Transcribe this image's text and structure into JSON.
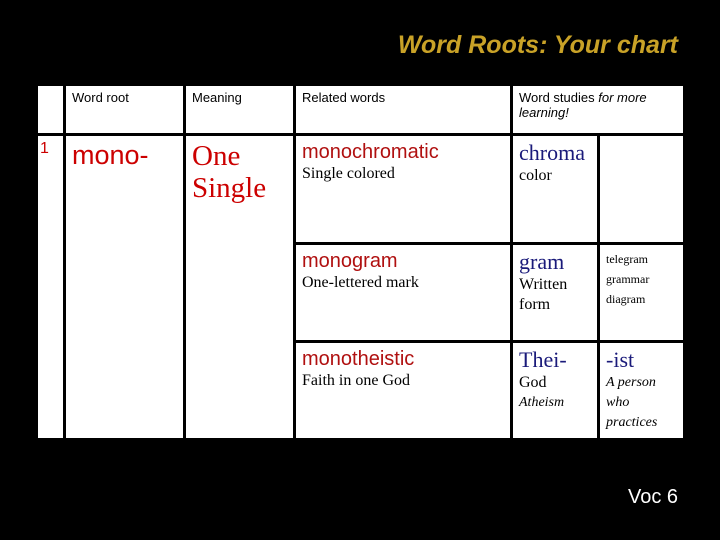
{
  "title": "Word Roots: Your chart",
  "header": {
    "col_number": "",
    "col_root": "Word root",
    "col_meaning": "Meaning",
    "col_related": "Related words",
    "col_studies_main": "Word studies ",
    "col_studies_italic": "for more learning!"
  },
  "entry": {
    "number": "1",
    "root": "mono-",
    "meaning_line1": "One",
    "meaning_line2": "Single"
  },
  "rows": [
    {
      "related_word": "monochromatic",
      "related_def": "Single colored",
      "study_word": "chroma",
      "study_def": "color",
      "study_example": "",
      "more_word": "",
      "more_items": []
    },
    {
      "related_word": "monogram",
      "related_def": "One-lettered mark",
      "study_word": "gram",
      "study_def": "Written form",
      "study_example": "",
      "more_word": "",
      "more_items": [
        "telegram",
        "grammar",
        "diagram"
      ]
    },
    {
      "related_word": "monotheistic",
      "related_def": "Faith in one God",
      "study_word": "Thei-",
      "study_def": "God",
      "study_example": "Atheism",
      "more_word": "-ist",
      "more_def": "A person who practices"
    }
  ],
  "footer": {
    "label": "Voc 6"
  },
  "colors": {
    "background": "#000000",
    "title": "#c9a227",
    "root_red": "#cc0000",
    "study_blue": "#1a1a7a"
  }
}
